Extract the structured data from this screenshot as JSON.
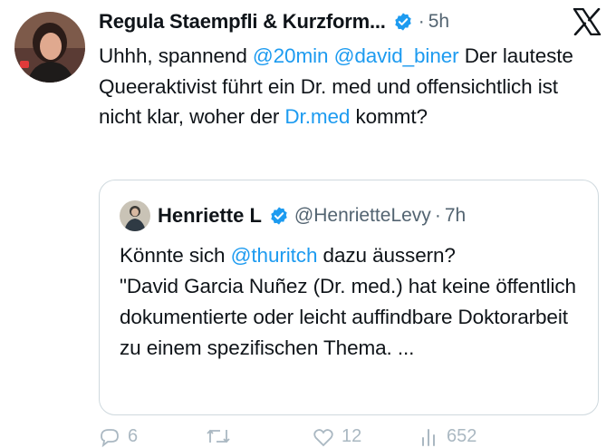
{
  "tweet": {
    "author_name": "Regula Staempfli & Kurzform...",
    "separator": "·",
    "time": "5h",
    "avatar_icon": "person-photo-icon",
    "text_segments": [
      {
        "text": "Uhhh, spannend ",
        "link": false
      },
      {
        "text": "@20min",
        "link": true
      },
      {
        "text": " ",
        "link": false
      },
      {
        "text": "@david_biner",
        "link": true
      },
      {
        "text": " Der lauteste Queeraktivist führt ein Dr. med und offensichtlich ist nicht klar, woher der ",
        "link": false
      },
      {
        "text": "Dr.med",
        "link": true
      },
      {
        "text": " kommt?",
        "link": false
      }
    ]
  },
  "quote": {
    "author_name": "Henriette L",
    "handle": "@HenrietteLevy",
    "separator": "·",
    "time": "7h",
    "text_segments": [
      {
        "text": "Könnte sich ",
        "link": false
      },
      {
        "text": "@thuritch",
        "link": true
      },
      {
        "text": " dazu äussern?",
        "link": false
      },
      {
        "text": "\n",
        "link": false
      },
      {
        "text": "\"David Garcia Nuñez (Dr. med.) hat keine öffentlich dokumentierte oder leicht auffindbare Doktorarbeit zu einem spezifischen Thema. ...",
        "link": false
      }
    ]
  },
  "actions": {
    "reply_count": "6",
    "retweet_count": "",
    "like_count": "12",
    "views_count": "652"
  },
  "colors": {
    "link": "#1d9bf0",
    "muted": "#536471",
    "border": "#cfd9de",
    "verified": "#1d9bf0"
  }
}
